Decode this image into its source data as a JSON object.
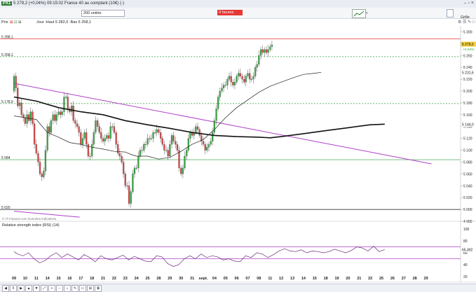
{
  "window": {
    "instrument": "PX1",
    "change": "5 279,2 (+0,04%)",
    "time": "09:15:02",
    "title": "France 40 au comptant (10€) (-)",
    "controls": "– ▫ ×"
  },
  "toolbar": {
    "units": "200 unités",
    "period": "4 heures",
    "grid_label": "Grille",
    "grid_icons": "⚙ ☰ ✎ □",
    "nav_icons": [
      "◀",
      "‖",
      "▶",
      "▲",
      "▼",
      "⤢",
      "+",
      "−",
      "⌂",
      "✎",
      "▭",
      "⊞",
      "⧉"
    ]
  },
  "info": {
    "prix": "Prix",
    "summary": "Jour :Haut 5 282,0 -Bas 5 258,1",
    "source": "© IT-Finance.com",
    "indicators": "Données indicatives"
  },
  "chart_data": {
    "type": "candlestick",
    "price_ylim": [
      4980,
      5310
    ],
    "price_ticks": [
      "5 300",
      "5 280",
      "5 260",
      "5 240",
      "5 220",
      "5 200",
      "5 180",
      "5 160",
      "5 140",
      "5 120",
      "5 100",
      "5 080",
      "5 060",
      "5 040",
      "5 020",
      "5 000",
      "4 980"
    ],
    "x_ticks": [
      "09",
      "10",
      "11",
      "14",
      "15",
      "16",
      "17",
      "18",
      "21",
      "22",
      "23",
      "24",
      "25",
      "28",
      "29",
      "30",
      "31",
      "sept.",
      "04",
      "05",
      "06",
      "07",
      "08",
      "11",
      "12",
      "13",
      "14",
      "15",
      "18",
      "19",
      "20",
      "21",
      "22",
      "25",
      "26",
      "27",
      "28",
      "29"
    ],
    "x_tick_days": [
      0,
      1,
      2,
      3,
      4,
      5,
      6,
      7,
      8,
      9,
      10,
      11,
      12,
      13,
      14,
      15,
      16,
      17,
      18,
      19,
      20,
      21,
      22,
      23,
      24,
      25,
      26,
      27,
      28,
      29,
      30,
      31,
      32,
      33,
      34,
      35,
      36,
      37
    ],
    "last_price": "5 279,2",
    "last_change": "+0,04%",
    "levels": [
      {
        "label": "5 288,1",
        "value": 5288.1,
        "color": "#e53935",
        "style": "solid"
      },
      {
        "label": "5 258,1",
        "value": 5258.1,
        "color": "#2e9e3a",
        "style": "dashed"
      },
      {
        "label": "5 231,6",
        "value": 5231.6,
        "color": "#444444",
        "style": "ma"
      },
      {
        "label": "5 178,9",
        "value": 5178.9,
        "color": "#2e9e3a",
        "style": "dashed"
      },
      {
        "label": "5 144,0",
        "value": 5144.0,
        "color": "#111111",
        "style": "ma"
      },
      {
        "label": "5 084",
        "value": 5084,
        "color": "#2e9e3a",
        "style": "solid"
      },
      {
        "label": "5 020",
        "value": 5000,
        "color": "#111111",
        "style": "solid"
      }
    ],
    "candles_day": [
      0.0,
      0.17,
      0.33,
      0.5,
      0.67,
      0.83,
      1.0,
      1.17,
      1.33,
      1.5,
      1.67,
      1.83,
      2.0,
      2.17,
      2.33,
      2.5,
      2.67,
      2.83,
      3.0,
      3.17,
      3.33,
      3.5,
      3.67,
      3.83,
      4.0,
      4.17,
      4.33,
      4.5,
      4.67,
      4.83,
      5.0,
      5.17,
      5.33,
      5.5,
      5.67,
      5.83,
      6.0,
      6.17,
      6.33,
      6.5,
      6.67,
      6.83,
      7.0,
      7.17,
      7.33,
      7.5,
      7.67,
      7.83,
      8.0,
      8.17,
      8.33,
      8.5,
      8.67,
      8.83,
      9.0,
      9.17,
      9.33,
      9.5,
      9.67,
      9.83,
      10.0,
      10.17,
      10.33,
      10.5,
      10.67,
      10.83,
      11.0,
      11.17,
      11.33,
      11.5,
      11.67,
      11.83,
      12.0,
      12.17,
      12.33,
      12.5,
      12.67,
      12.83,
      13.0,
      13.17,
      13.33,
      13.5,
      13.67,
      13.83,
      14.0,
      14.17,
      14.33,
      14.5,
      14.67,
      14.83,
      15.0,
      15.17,
      15.33,
      15.5,
      15.67,
      15.83,
      16.0,
      16.17,
      16.33,
      16.5,
      16.67,
      16.83,
      17.0,
      17.17,
      17.33,
      17.5,
      17.67,
      17.83,
      18.0,
      18.17,
      18.33,
      18.5,
      18.67,
      18.83,
      19.0,
      19.17,
      19.33,
      19.5,
      19.67,
      19.83,
      20.0,
      20.17,
      20.33,
      20.5,
      20.67,
      20.83,
      21.0,
      21.17,
      21.33,
      21.5,
      21.67,
      21.83,
      22.0,
      22.17,
      22.33,
      22.5,
      22.67,
      22.83,
      23.0,
      23.17,
      23.33,
      23.5,
      23.67,
      23.83,
      24.0,
      24.17,
      24.33,
      24.5,
      24.67,
      24.83,
      25.0,
      25.17,
      25.33,
      25.5,
      25.67,
      25.83,
      26.0,
      26.17,
      26.33,
      26.5,
      26.67,
      26.83,
      27.0,
      27.17,
      27.33,
      27.5,
      27.67,
      27.83,
      28.0,
      28.17,
      28.33,
      28.5,
      28.67,
      28.83,
      29.0,
      29.17,
      29.33,
      29.5,
      29.67,
      29.83,
      30.0,
      30.17,
      30.33,
      30.5,
      30.67,
      30.83,
      31.0,
      31.17,
      31.33,
      31.5,
      31.67,
      31.83,
      32.0,
      32.17,
      32.33,
      32.5,
      32.67,
      32.83,
      33.0,
      33.17,
      33.33
    ],
    "candles_close": [
      5225,
      5205,
      5175,
      5180,
      5160,
      5155,
      5145,
      5160,
      5150,
      5165,
      5145,
      5110,
      5095,
      5080,
      5060,
      5055,
      5065,
      5100,
      5140,
      5130,
      5150,
      5160,
      5150,
      5160,
      5165,
      5160,
      5165,
      5190,
      5190,
      5170,
      5165,
      5175,
      5150,
      5145,
      5140,
      5130,
      5110,
      5120,
      5130,
      5110,
      5090,
      5090,
      5110,
      5130,
      5150,
      5140,
      5130,
      5120,
      5115,
      5120,
      5125,
      5120,
      5140,
      5140,
      5130,
      5110,
      5095,
      5090,
      5080,
      5060,
      5040,
      5040,
      5010,
      5030,
      5060,
      5070,
      5070,
      5090,
      5100,
      5100,
      5110,
      5110,
      5120,
      5120,
      5120,
      5130,
      5130,
      5135,
      5130,
      5120,
      5110,
      5100,
      5100,
      5090,
      5110,
      5125,
      5115,
      5110,
      5100,
      5070,
      5060,
      5070,
      5090,
      5100,
      5120,
      5130,
      5125,
      5130,
      5140,
      5135,
      5125,
      5115,
      5110,
      5100,
      5105,
      5110,
      5115,
      5130,
      5150,
      5170,
      5190,
      5200,
      5205,
      5210,
      5210,
      5220,
      5225,
      5215,
      5210,
      5215,
      5225,
      5230,
      5225,
      5220,
      5215,
      5225,
      5230,
      5220,
      5220,
      5225,
      5240,
      5245,
      5260,
      5270,
      5265,
      5270,
      5265,
      5270,
      5275,
      5278
    ],
    "ma_long": [
      [
        0,
        5190
      ],
      [
        2,
        5183
      ],
      [
        4,
        5172
      ],
      [
        6,
        5165
      ],
      [
        8,
        5160
      ],
      [
        10,
        5150
      ],
      [
        12,
        5143
      ],
      [
        14,
        5137
      ],
      [
        16,
        5130
      ],
      [
        18,
        5125
      ],
      [
        20,
        5123
      ],
      [
        22,
        5122
      ],
      [
        23,
        5121
      ],
      [
        24,
        5123
      ],
      [
        26,
        5128
      ],
      [
        28,
        5133
      ],
      [
        30,
        5138
      ],
      [
        32,
        5143
      ],
      [
        33.3,
        5144
      ]
    ],
    "ma_short": [
      [
        0,
        5158
      ],
      [
        2,
        5152
      ],
      [
        3,
        5130
      ],
      [
        4,
        5122
      ],
      [
        5,
        5113
      ],
      [
        6,
        5110
      ],
      [
        7,
        5105
      ],
      [
        8,
        5102
      ],
      [
        9,
        5098
      ],
      [
        10,
        5097
      ],
      [
        10.5,
        5093
      ],
      [
        11,
        5090
      ],
      [
        12,
        5090
      ],
      [
        13,
        5085
      ],
      [
        14,
        5088
      ],
      [
        15,
        5098
      ],
      [
        16,
        5110
      ],
      [
        17,
        5118
      ],
      [
        18,
        5135
      ],
      [
        19,
        5155
      ],
      [
        20,
        5172
      ],
      [
        21,
        5185
      ],
      [
        22,
        5198
      ],
      [
        23,
        5208
      ],
      [
        24,
        5215
      ],
      [
        25,
        5222
      ],
      [
        26,
        5228
      ],
      [
        27,
        5230
      ],
      [
        27.6,
        5231.6
      ]
    ],
    "trendlines": [
      {
        "from": [
          0,
          5213
        ],
        "to": [
          37.5,
          5077
        ]
      },
      {
        "from": [
          0,
          4997
        ],
        "to": [
          5.9,
          4987
        ]
      }
    ],
    "rsi": {
      "label": "Relative strength index (RSI) (14)",
      "last": "65,492",
      "ylim": [
        20,
        100
      ],
      "ticks": [
        "100",
        "80",
        "60",
        "40",
        "20"
      ],
      "guides": [
        70,
        50
      ],
      "points": [
        [
          0,
          62
        ],
        [
          0.3,
          58
        ],
        [
          0.8,
          55
        ],
        [
          1.3,
          60
        ],
        [
          1.8,
          50
        ],
        [
          2.3,
          43
        ],
        [
          2.8,
          47
        ],
        [
          3.3,
          55
        ],
        [
          3.8,
          60
        ],
        [
          4.3,
          52
        ],
        [
          4.8,
          58
        ],
        [
          5.3,
          53
        ],
        [
          5.8,
          48
        ],
        [
          6.3,
          57
        ],
        [
          6.8,
          52
        ],
        [
          7.3,
          45
        ],
        [
          7.8,
          55
        ],
        [
          8.3,
          50
        ],
        [
          8.8,
          48
        ],
        [
          9.3,
          52
        ],
        [
          9.8,
          56
        ],
        [
          10.3,
          48
        ],
        [
          10.8,
          54
        ],
        [
          11.3,
          50
        ],
        [
          11.8,
          46
        ],
        [
          12.3,
          45
        ],
        [
          12.8,
          55
        ],
        [
          13.3,
          53
        ],
        [
          13.8,
          42
        ],
        [
          14.3,
          37
        ],
        [
          14.8,
          40
        ],
        [
          15.3,
          50
        ],
        [
          15.8,
          55
        ],
        [
          16.3,
          50
        ],
        [
          16.8,
          58
        ],
        [
          17.3,
          52
        ],
        [
          17.8,
          55
        ],
        [
          18.3,
          53
        ],
        [
          18.8,
          48
        ],
        [
          19.3,
          50
        ],
        [
          19.8,
          46
        ],
        [
          20.3,
          45
        ],
        [
          20.8,
          55
        ],
        [
          21.3,
          52
        ],
        [
          21.8,
          60
        ],
        [
          22.3,
          58
        ],
        [
          22.8,
          52
        ],
        [
          23.3,
          57
        ],
        [
          23.8,
          63
        ],
        [
          24.3,
          67
        ],
        [
          24.8,
          63
        ],
        [
          25.3,
          62
        ],
        [
          25.8,
          65
        ],
        [
          26.3,
          60
        ],
        [
          26.8,
          63
        ],
        [
          27.3,
          62
        ],
        [
          27.8,
          60
        ],
        [
          28.3,
          62
        ],
        [
          28.8,
          66
        ],
        [
          29.3,
          63
        ],
        [
          29.8,
          60
        ],
        [
          30.3,
          64
        ],
        [
          30.8,
          70
        ],
        [
          31.3,
          68
        ],
        [
          31.8,
          63
        ],
        [
          32.3,
          71
        ],
        [
          32.8,
          62
        ],
        [
          33.3,
          65.5
        ]
      ]
    }
  }
}
